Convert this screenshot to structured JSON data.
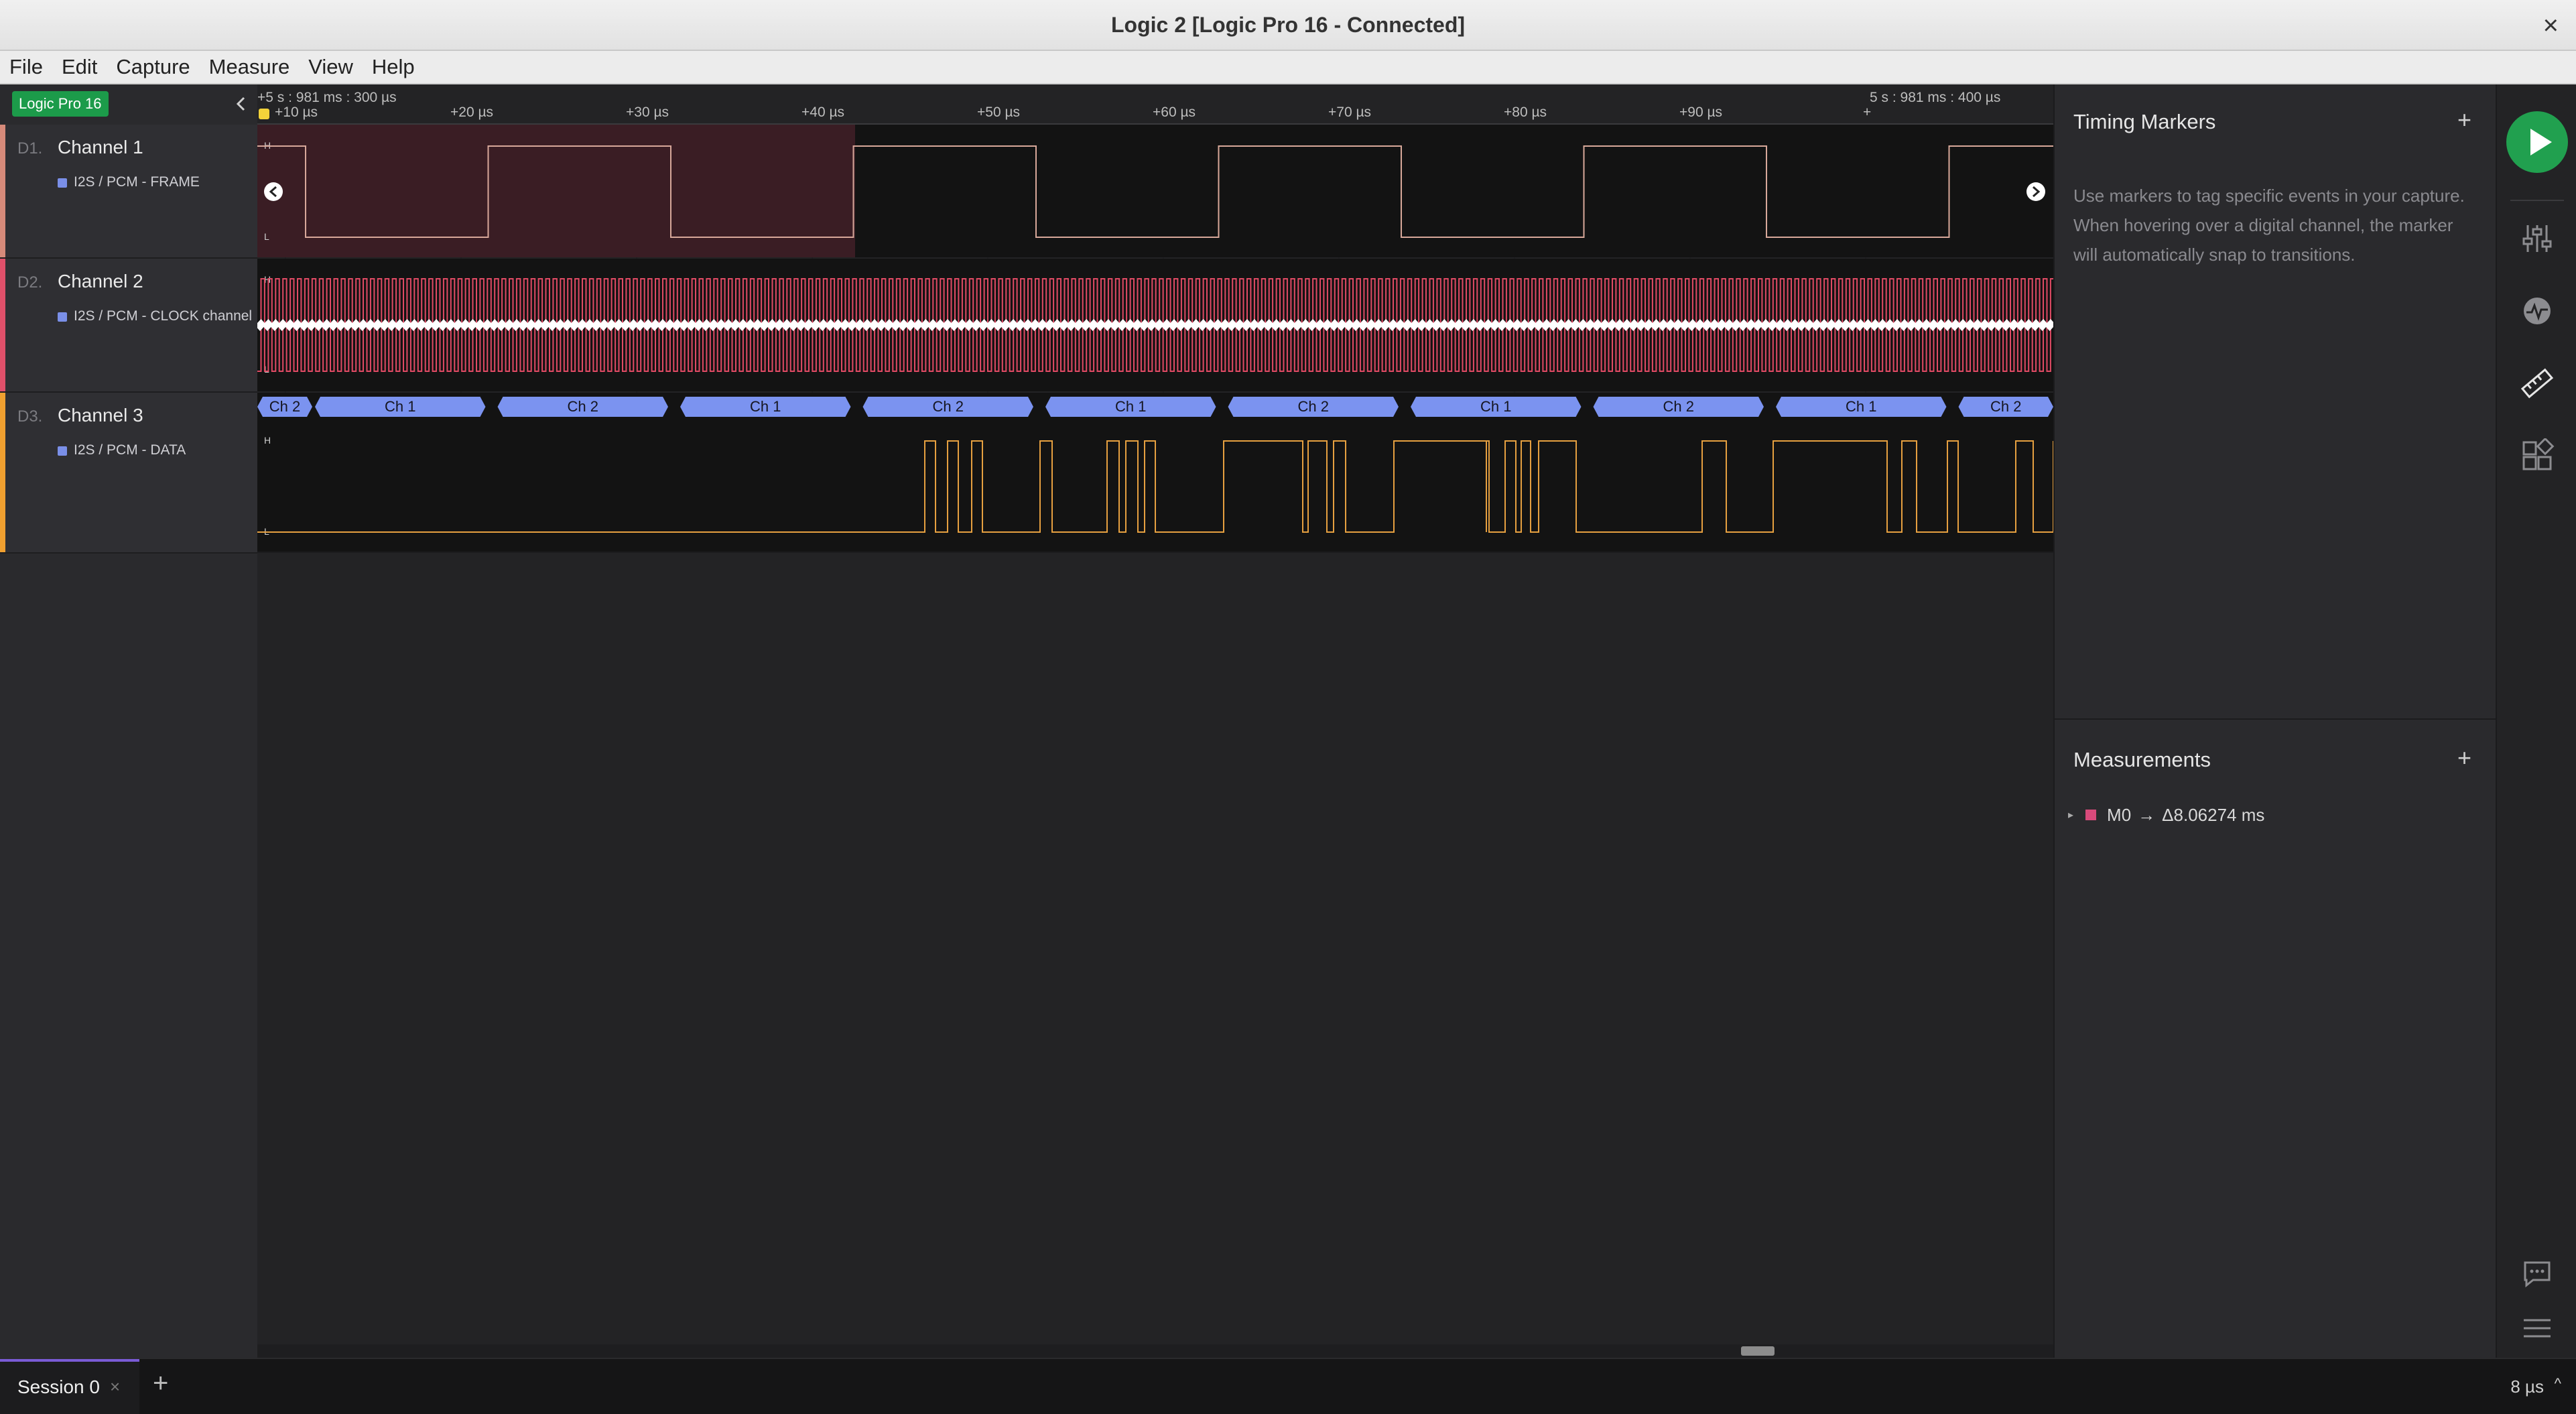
{
  "window": {
    "title": "Logic 2 [Logic Pro 16 - Connected]",
    "close_glyph": "×"
  },
  "menu": [
    "File",
    "Edit",
    "Capture",
    "Measure",
    "View",
    "Help"
  ],
  "device": {
    "label": "Logic Pro 16"
  },
  "channels": [
    {
      "num": "D1.",
      "name": "Channel 1",
      "analyzer": "I2S / PCM - FRAME",
      "color": "#d68a7a"
    },
    {
      "num": "D2.",
      "name": "Channel 2",
      "analyzer": "I2S / PCM - CLOCK channel",
      "color": "#e0506a"
    },
    {
      "num": "D3.",
      "name": "Channel 3",
      "analyzer": "I2S / PCM - DATA",
      "color": "#f0a030"
    }
  ],
  "timeline": {
    "start_label": "+5 s : 981 ms : 300 µs",
    "end_label": "5 s : 981 ms : 400 µs",
    "ticks": [
      "+10 µs",
      "+20 µs",
      "+30 µs",
      "+40 µs",
      "+50 µs",
      "+60 µs",
      "+70 µs",
      "+80 µs",
      "+90 µs",
      "+"
    ]
  },
  "levels": {
    "high": "H",
    "low": "L"
  },
  "decoded_frames": [
    "Ch 2",
    "Ch 1",
    "Ch 2",
    "Ch 1",
    "Ch 2",
    "Ch 1",
    "Ch 2",
    "Ch 1",
    "Ch 2",
    "Ch 1",
    "Ch 2"
  ],
  "sidebar": {
    "timing_markers_title": "Timing Markers",
    "timing_markers_help": "Use markers to tag specific events in your capture. When hovering over a digital channel, the marker will automatically snap to transitions.",
    "measurements_title": "Measurements",
    "add_glyph": "+",
    "measurement": {
      "name": "M0",
      "arrow": "→",
      "value": "Δ8.06274 ms",
      "color": "#d84a7b"
    }
  },
  "icons": {
    "run": "play-icon",
    "strip": [
      "sliders-icon",
      "analyzer-icon",
      "ruler-icon",
      "extensions-icon",
      "feedback-icon",
      "menu-icon"
    ]
  },
  "session": {
    "tab_label": "Session 0",
    "close_glyph": "×",
    "add_glyph": "+"
  },
  "status": {
    "time_per_div": "8 µs",
    "caret": "^"
  },
  "colors": {
    "frame_signal": "#d8a89a",
    "clock_signal": "#e04a64",
    "data_signal": "#e6a040",
    "decoder_bubble": "#7b93f0",
    "highlight": "#5a2a36",
    "run_green": "#21a04f"
  }
}
